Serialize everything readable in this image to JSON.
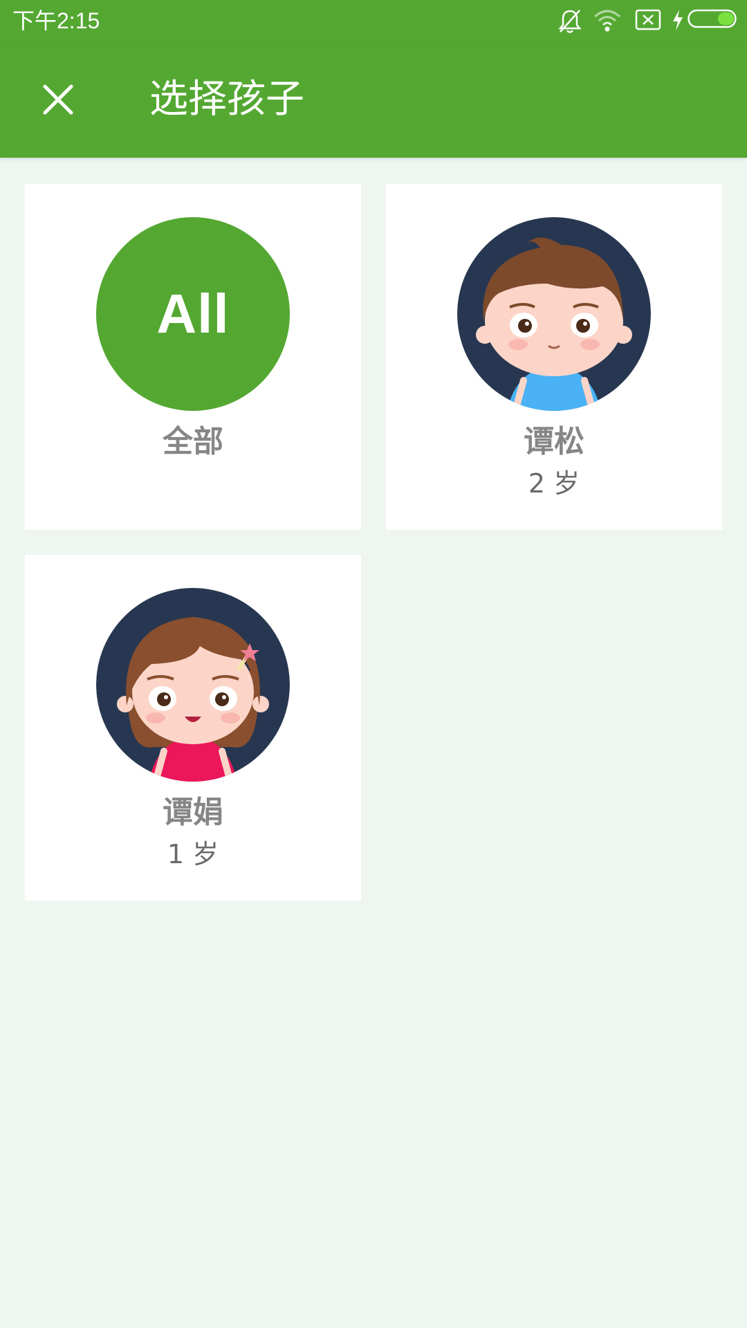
{
  "status_bar": {
    "time": "下午2:15",
    "icons": [
      "bell-off-icon",
      "wifi-icon",
      "no-sim-icon",
      "charging-icon",
      "battery-icon"
    ],
    "accent_color": "#54a832"
  },
  "app_bar": {
    "close_icon": "close-icon",
    "title": "选择孩子"
  },
  "children": [
    {
      "name": "全部",
      "avatar_text": "All",
      "age": ""
    },
    {
      "name": "谭松",
      "avatar": "boy-avatar-icon",
      "age": "2 岁"
    },
    {
      "name": "谭娟",
      "avatar": "girl-avatar-icon",
      "age": "1 岁"
    }
  ]
}
